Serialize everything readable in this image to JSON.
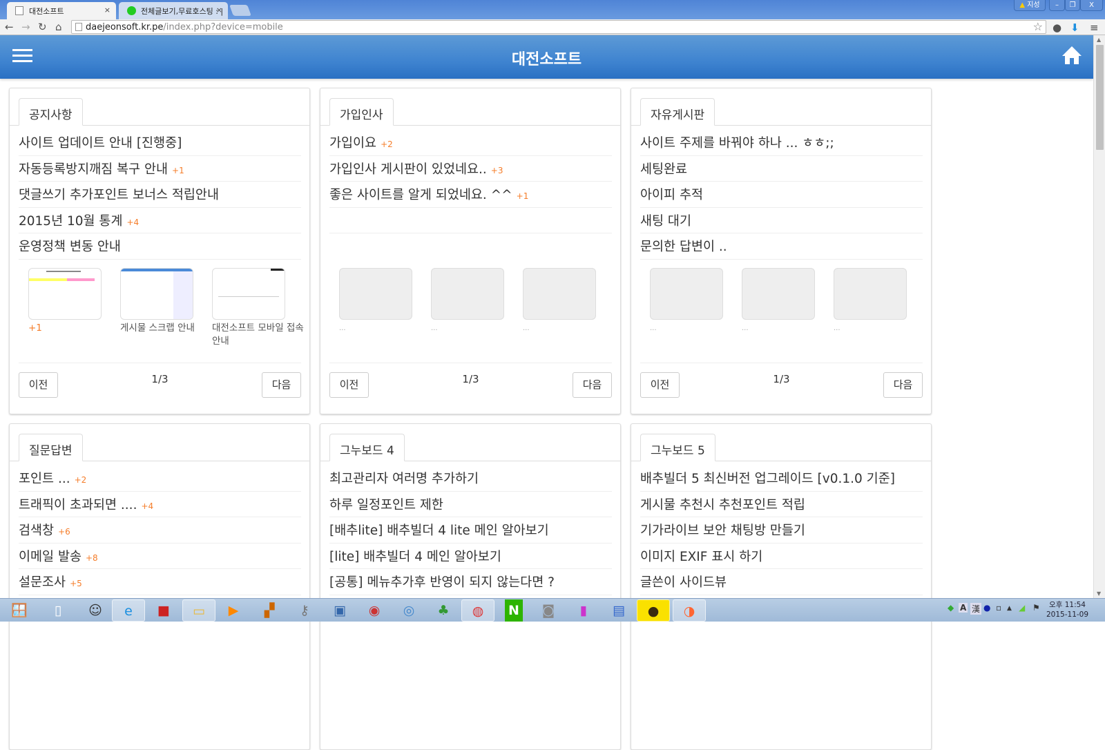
{
  "browser": {
    "tabs": [
      {
        "title": "대전소프트",
        "active": true
      },
      {
        "title": "전체글보기,무료호스팅 : |",
        "active": false
      }
    ],
    "close_glyph": "×",
    "window_label": "지성",
    "window_controls": [
      "–",
      "❐",
      "X"
    ],
    "url_host": "daejeonsoft.kr.pe",
    "url_path": "/index.php?device=mobile"
  },
  "header": {
    "title": "대전소프트",
    "menu_icon": "hamburger-icon",
    "home_icon": "home-icon",
    "bg": "#3f84d0"
  },
  "pager_labels": {
    "prev": "이전",
    "next": "다음"
  },
  "cards": [
    {
      "tab": "공지사항",
      "items": [
        {
          "text": "사이트 업데이트 안내 [진행중]"
        },
        {
          "text": "자동등록방지깨짐 복구 안내",
          "count": "+1"
        },
        {
          "text": "댓글쓰기 추가포인트 보너스 적립안내"
        },
        {
          "text": "2015년 10월 통계",
          "count": "+4"
        },
        {
          "text": "운영정책 변동 안내"
        }
      ],
      "thumbs": [
        {
          "caption": "",
          "count": "+1",
          "image": true
        },
        {
          "caption": "게시물 스크랩 안내",
          "image": true
        },
        {
          "caption": "대전소프트 모바일 접속 안내",
          "image": true
        }
      ],
      "page": "1/3"
    },
    {
      "tab": "가입인사",
      "items": [
        {
          "text": "가입이요",
          "count": "+2"
        },
        {
          "text": "가입인사 게시판이 있었네요..",
          "count": "+3"
        },
        {
          "text": "좋은 사이트를 알게 되었네요. ^^",
          "count": "+1"
        },
        {
          "text": ""
        }
      ],
      "thumbs": [
        {
          "caption": "...",
          "image": false
        },
        {
          "caption": "...",
          "image": false
        },
        {
          "caption": "...",
          "image": false
        }
      ],
      "page": "1/3"
    },
    {
      "tab": "자유게시판",
      "items": [
        {
          "text": "사이트 주제를 바꿔야 하나 ... ㅎㅎ;;"
        },
        {
          "text": "세팅완료"
        },
        {
          "text": "아이피 추적"
        },
        {
          "text": "새팅 대기"
        },
        {
          "text": "문의한 답변이 .."
        }
      ],
      "thumbs": [
        {
          "caption": "...",
          "image": false
        },
        {
          "caption": "...",
          "image": false
        },
        {
          "caption": "...",
          "image": false
        }
      ],
      "page": "1/3"
    },
    {
      "tab": "질문답변",
      "items": [
        {
          "text": "포인트 ...",
          "count": "+2"
        },
        {
          "text": "트래픽이 초과되면 ....",
          "count": "+4"
        },
        {
          "text": "검색창",
          "count": "+6"
        },
        {
          "text": "이메일 발송",
          "count": "+8"
        },
        {
          "text": "설문조사",
          "count": "+5"
        }
      ]
    },
    {
      "tab": "그누보드 4",
      "items": [
        {
          "text": "최고관리자 여러명 추가하기"
        },
        {
          "text": "하루 일정포인트 제한"
        },
        {
          "text": "[배추lite] 배추빌더 4 lite 메인 알아보기"
        },
        {
          "text": "[lite] 배추빌더 4 메인 알아보기"
        },
        {
          "text": "[공통] 메뉴추가후 반영이 되지 않는다면 ?"
        }
      ]
    },
    {
      "tab": "그누보드 5",
      "items": [
        {
          "text": "배추빌더 5 최신버전 업그레이드 [v0.1.0 기준]"
        },
        {
          "text": "게시물 추천시 추천포인트 적립"
        },
        {
          "text": "기가라이브 보안 채팅방 만들기"
        },
        {
          "text": "이미지 EXIF 표시 하기"
        },
        {
          "text": "글쓴이 사이드뷰"
        }
      ]
    }
  ],
  "taskbar": {
    "apps": [
      "start",
      "file",
      "game",
      "ie",
      "app-red",
      "explorer",
      "media-player",
      "movie-maker",
      "keys",
      "remote-desktop",
      "recorder",
      "safari",
      "sprout",
      "chrome",
      "naver",
      "camera",
      "ink",
      "document",
      "kakaotalk",
      "presenter"
    ],
    "clock_time": "오후 11:54",
    "clock_date": "2015-11-09"
  }
}
